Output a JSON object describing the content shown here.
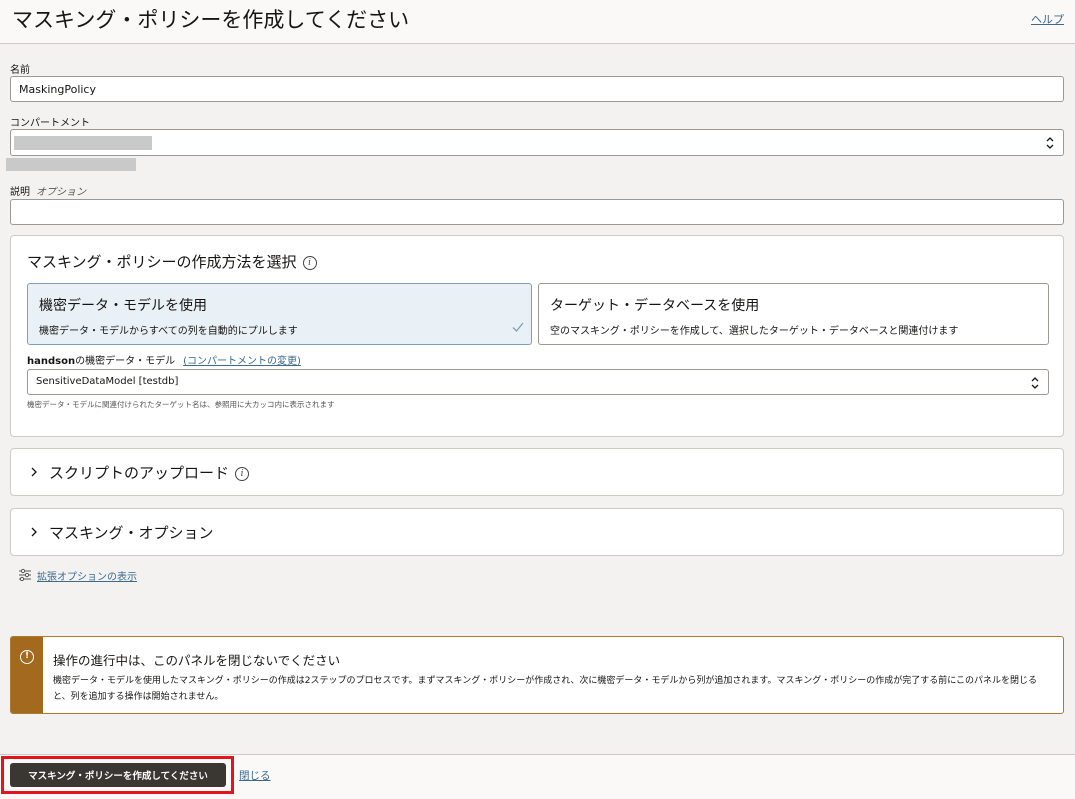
{
  "header": {
    "title": "マスキング・ポリシーを作成してください",
    "help_label": "ヘルプ"
  },
  "form": {
    "name_label": "名前",
    "name_value": "MaskingPolicy",
    "compartment_label": "コンパートメント",
    "description_label": "説明",
    "description_optional": "オプション",
    "description_value": ""
  },
  "method_panel": {
    "title": "マスキング・ポリシーの作成方法を選択",
    "options": [
      {
        "title": "機密データ・モデルを使用",
        "description": "機密データ・モデルからすべての列を自動的にプルします",
        "selected": true
      },
      {
        "title": "ターゲット・データベースを使用",
        "description": "空のマスキング・ポリシーを作成して、選択したターゲット・データベースと関連付けます",
        "selected": false
      }
    ],
    "sdm_compartment": "handson",
    "sdm_label": "の機密データ・モデル",
    "change_compartment_link": "(コンパートメントの変更)",
    "sdm_value": "SensitiveDataModel [testdb]",
    "sdm_hint": "機密データ・モデルに関連付けられたターゲット名は、参照用に大カッコ内に表示されます"
  },
  "sections": {
    "upload_script": "スクリプトのアップロード",
    "masking_options": "マスキング・オプション"
  },
  "advanced_link": "拡張オプションの表示",
  "warning": {
    "title": "操作の進行中は、このパネルを閉じないでください",
    "body": "機密データ・モデルを使用したマスキング・ポリシーの作成は2ステップのプロセスです。まずマスキング・ポリシーが作成され、次に機密データ・モデルから列が追加されます。マスキング・ポリシーの作成が完了する前にこのパネルを閉じると、列を追加する操作は開始されません。"
  },
  "footer": {
    "create_button": "マスキング・ポリシーを作成してください",
    "close_link": "閉じる"
  },
  "colors": {
    "link": "#3b6a8d",
    "primary_button": "#3a3631",
    "warning_accent": "#a36a1f",
    "highlight_border": "#e3141b",
    "selected_card": "#eaf1f6"
  },
  "icons": [
    "info-icon",
    "chevron-updown-icon",
    "check-icon",
    "chevron-right-icon",
    "sliders-icon",
    "warning-icon"
  ]
}
